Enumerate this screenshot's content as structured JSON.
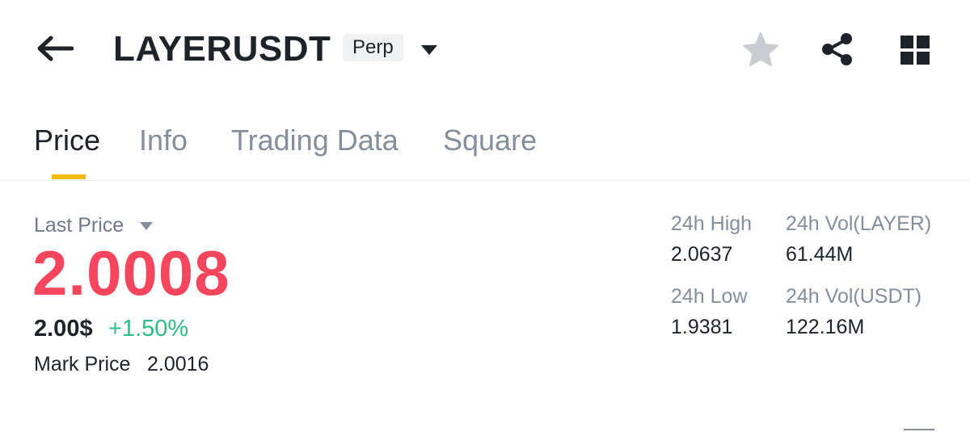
{
  "header": {
    "symbol": "LAYERUSDT",
    "contract_type": "Perp",
    "icons": [
      "back-arrow-icon",
      "caret-down-icon",
      "star-icon",
      "share-icon",
      "grid-icon"
    ]
  },
  "tabs": [
    {
      "label": "Price",
      "active": true
    },
    {
      "label": "Info",
      "active": false
    },
    {
      "label": "Trading Data",
      "active": false
    },
    {
      "label": "Square",
      "active": false
    }
  ],
  "price": {
    "last_price_label": "Last Price",
    "last_price": "2.0008",
    "usd_price": "2.00$",
    "change_pct": "+1.50%",
    "mark_price_label": "Mark Price",
    "mark_price": "2.0016"
  },
  "stats": {
    "high_label": "24h High",
    "high_value": "2.0637",
    "low_label": "24h Low",
    "low_value": "1.9381",
    "vol_base_label": "24h Vol(LAYER)",
    "vol_base_value": "61.44M",
    "vol_quote_label": "24h Vol(USDT)",
    "vol_quote_value": "122.16M"
  },
  "colors": {
    "primary_text": "#1e2329",
    "secondary_text": "#848e9c",
    "negative": "#f6465d",
    "positive": "#2ebd85",
    "accent": "#f0b90b"
  }
}
